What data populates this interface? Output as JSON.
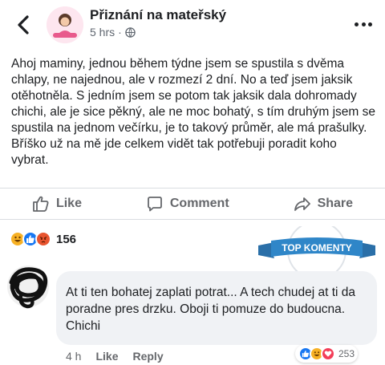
{
  "header": {
    "page_name": "Přiznání na mateřský",
    "time": "5 hrs",
    "separator": "·",
    "icons": {
      "back": "back-arrow-icon",
      "globe": "globe-icon",
      "more": "more-icon"
    }
  },
  "post": {
    "text": "Ahoj maminy, jednou během týdne jsem se spustila s dvěma chlapy, ne najednou, ale v rozmezí 2 dní. No a teď jsem jaksik otěhotněla. S jedním jsem se potom tak jaksik dala dohromady chichi, ale je sice pěkný, ale ne moc bohatý, s tím druhým jsem se spustila na jednom večírku, je to takový průměr, ale má prašulky. Bříško už na mě jde celkem vidět tak potřebuji poradit koho vybrat."
  },
  "actions": {
    "like": "Like",
    "comment": "Comment",
    "share": "Share"
  },
  "reactions": {
    "count": "156",
    "types": [
      "haha",
      "like",
      "angry"
    ]
  },
  "badge": {
    "text": "TOP KOMENTY"
  },
  "comment": {
    "text": "At ti ten bohatej zaplati potrat... A tech chudej at ti da poradne pres drzku. Oboji ti pomuze do budoucna. Chichi",
    "time": "4 h",
    "like": "Like",
    "reply": "Reply",
    "reaction_count": "253",
    "reaction_types": [
      "like",
      "haha",
      "love"
    ]
  },
  "colors": {
    "accent": "#1877f2",
    "text": "#1c1e21",
    "muted": "#65676b",
    "bubble": "#f0f2f5",
    "badge": "#2f86c8"
  }
}
